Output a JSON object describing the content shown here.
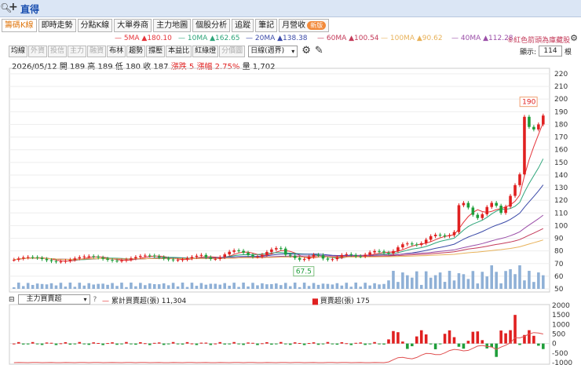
{
  "window": {
    "search_icon": "search-icon",
    "plus": "+",
    "stock_name": "直得"
  },
  "tabs": [
    {
      "label": "籌碼K線",
      "active": true
    },
    {
      "label": "即時走勢"
    },
    {
      "label": "分點K線"
    },
    {
      "label": "大單券商"
    },
    {
      "label": "主力地圖"
    },
    {
      "label": "個股分析"
    },
    {
      "label": "追蹤"
    },
    {
      "label": "筆記"
    },
    {
      "label": "月營收",
      "badge": "新版"
    }
  ],
  "ma_legend": {
    "ma5": {
      "label": "5MA",
      "value": "180.10",
      "color": "#e5343a"
    },
    "ma10": {
      "label": "10MA",
      "value": "162.65",
      "color": "#2ea57a"
    },
    "ma20": {
      "label": "20MA",
      "value": "138.38",
      "color": "#3b4aa8"
    },
    "ma60": {
      "label": "60MA",
      "value": "100.54",
      "color": "#c43b5a"
    },
    "ma100": {
      "label": "100MA",
      "value": "90.62",
      "color": "#e8b25a"
    },
    "ma40": {
      "label": "40MA",
      "value": "112.28",
      "color": "#9b4fa8"
    },
    "note": "⑥紅色箭頭為庫藏股"
  },
  "toolbar": {
    "buttons": [
      {
        "label": "均線",
        "dim": false
      },
      {
        "label": "外資",
        "dim": true
      },
      {
        "label": "投信",
        "dim": true
      },
      {
        "label": "主力",
        "dim": true
      },
      {
        "label": "融資",
        "dim": true
      },
      {
        "label": "布林",
        "dim": false
      },
      {
        "label": "趨勢",
        "dim": false
      },
      {
        "label": "撐壓",
        "dim": false
      },
      {
        "label": "本益比",
        "dim": false
      },
      {
        "label": "紅綠燈",
        "dim": false
      },
      {
        "label": "分價圖",
        "dim": true
      }
    ],
    "period": "日線(週界)",
    "settings_icon": "gear-icon",
    "draw_icon": "pencil-icon",
    "show_label": "顯示:",
    "show_value": "114",
    "show_unit": "根"
  },
  "info": {
    "date": "2026/05/12",
    "open_label": "開",
    "open": "189",
    "high_label": "高",
    "high": "189",
    "low_label": "低",
    "low": "180",
    "close_label": "收",
    "close": "187",
    "change_label": "漲跌",
    "change": "5",
    "pct_label": "漲幅",
    "pct": "2.75%",
    "vol_label": "量",
    "vol": "1,702"
  },
  "price_axis": [
    "220",
    "210",
    "200",
    "190",
    "180",
    "170",
    "160",
    "150",
    "140",
    "130",
    "120",
    "110",
    "100",
    "90",
    "80",
    "70",
    "60",
    "50"
  ],
  "annotations": {
    "high_mark": "190",
    "low_mark": "67.5"
  },
  "indicator": {
    "select_value": "主力買賣超",
    "help": "?",
    "cum_label": "累計買賣超(張)",
    "cum_value": "11,304",
    "net_label": "買賣超(張)",
    "net_value": "175",
    "axis": [
      "2000",
      "1500",
      "1000",
      "500",
      "0",
      "-500",
      "-1000"
    ]
  },
  "colors": {
    "up": "#e02020",
    "down": "#1f9e3a",
    "vol": "#8fb0d6"
  }
}
